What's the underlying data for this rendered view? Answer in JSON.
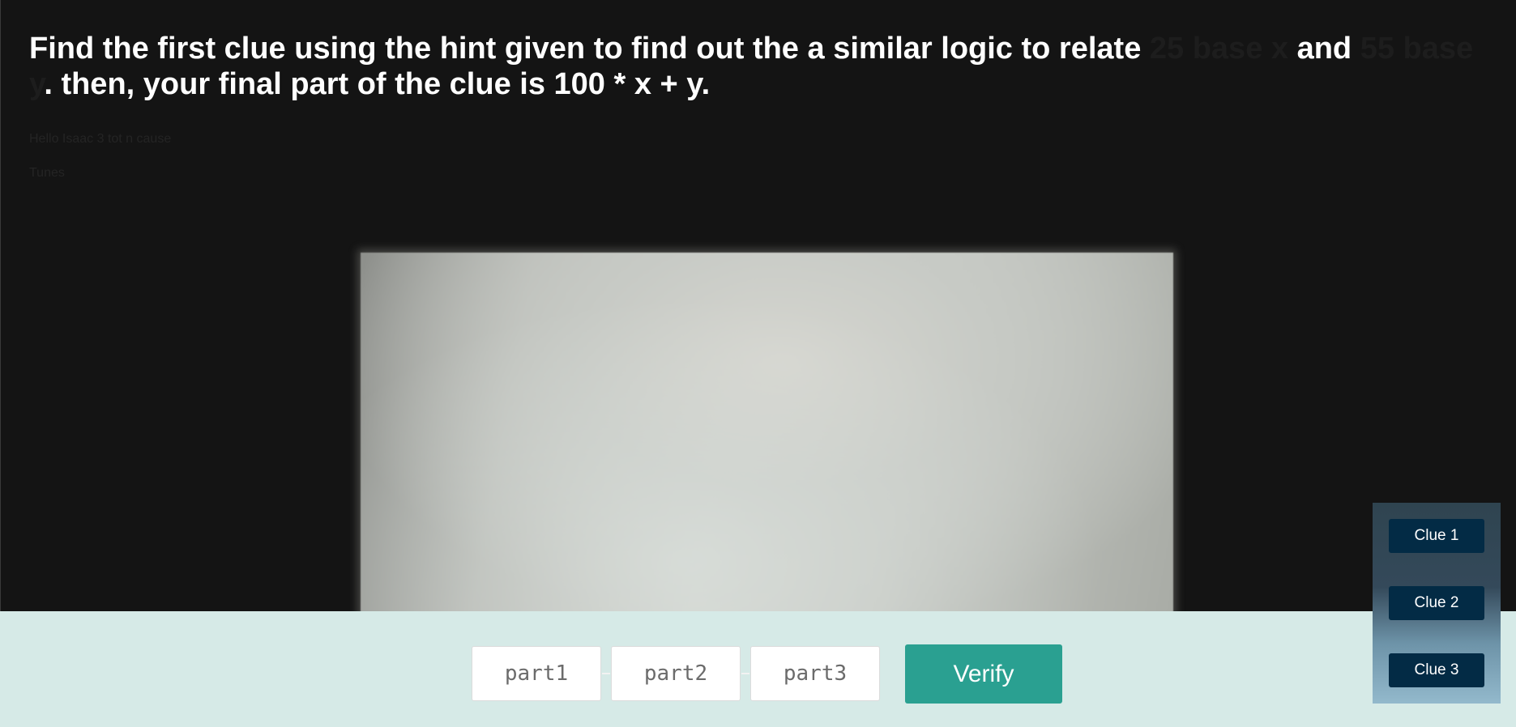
{
  "header": {
    "text_before": "Find the first clue using the hint given to find out the a similar logic to relate ",
    "hidden_1": "25 base x",
    "text_middle": " and ",
    "hidden_2": "55 base y",
    "text_after": ". then, your final part of the clue is 100 * x + y."
  },
  "faint_lines": [
    "Hello Isaac 3 tot n cause",
    "Tunes"
  ],
  "inputs": {
    "part1_placeholder": "part1",
    "part2_placeholder": "part2",
    "part3_placeholder": "part3"
  },
  "verify": {
    "label": "Verify",
    "color": "#2aa091"
  },
  "clues": [
    {
      "label": "Clue 1"
    },
    {
      "label": "Clue 2"
    },
    {
      "label": "Clue 3"
    }
  ],
  "colors": {
    "background": "#141414",
    "bottom_bar": "#d6eae7",
    "clue_button": "#032b45"
  }
}
